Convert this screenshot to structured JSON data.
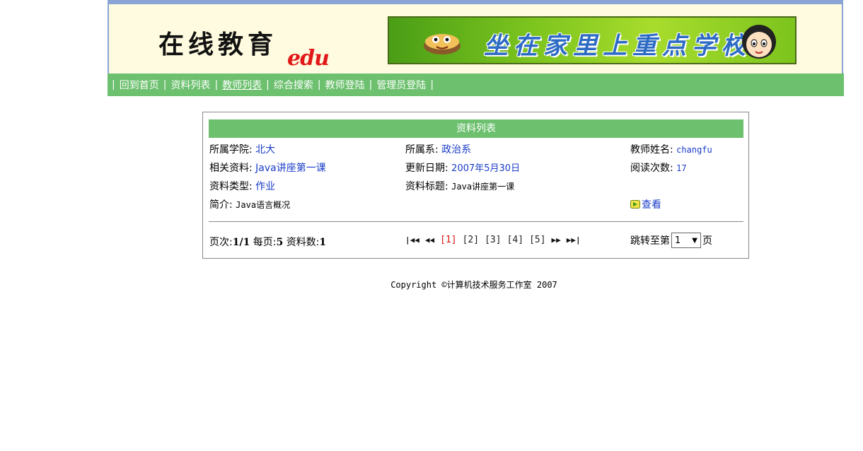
{
  "header": {
    "logo_text": "在线教育",
    "logo_suffix": "edu",
    "slogan": "坐在家里上重点学校"
  },
  "nav": {
    "items": [
      {
        "label": "回到首页",
        "active": false
      },
      {
        "label": "资料列表",
        "active": false
      },
      {
        "label": "教师列表",
        "active": true
      },
      {
        "label": "综合搜索",
        "active": false
      },
      {
        "label": "教师登陆",
        "active": false
      },
      {
        "label": "管理员登陆",
        "active": false
      }
    ],
    "separator": "|"
  },
  "panel": {
    "title": "资料列表",
    "college_label": "所属学院:",
    "college_value": "北大",
    "dept_label": "所属系:",
    "dept_value": "政治系",
    "teacher_label": "教师姓名:",
    "teacher_value": "changfu",
    "material_label": "相关资料:",
    "material_value": "Java讲座第一课",
    "date_label": "更新日期:",
    "date_value": "2007年5月30日",
    "reads_label": "阅读次数:",
    "reads_value": "17",
    "type_label": "资料类型:",
    "type_value": "作业",
    "title_label": "资料标题:",
    "title_value": "Java讲座第一课",
    "intro_label": "简介:",
    "intro_value": "Java语言概况",
    "view_label": "查看"
  },
  "pager": {
    "page_label": "页次:",
    "page_value": "1/1",
    "per_page_label": "每页:",
    "per_page_value": "5",
    "count_label": "资料数:",
    "count_value": "1",
    "pages": [
      "[1]",
      "[2]",
      "[3]",
      "[4]",
      "[5]"
    ],
    "current_page": "[1]",
    "jump_prefix": "跳转至第",
    "jump_value": "1",
    "jump_suffix": "页"
  },
  "footer": {
    "text": "Copyright ©计算机技术服务工作室 2007"
  },
  "colors": {
    "nav_green": "#6cc06e",
    "link_blue": "#1a3cc8",
    "current_red": "#d81010",
    "header_bg": "#fffbe0"
  }
}
